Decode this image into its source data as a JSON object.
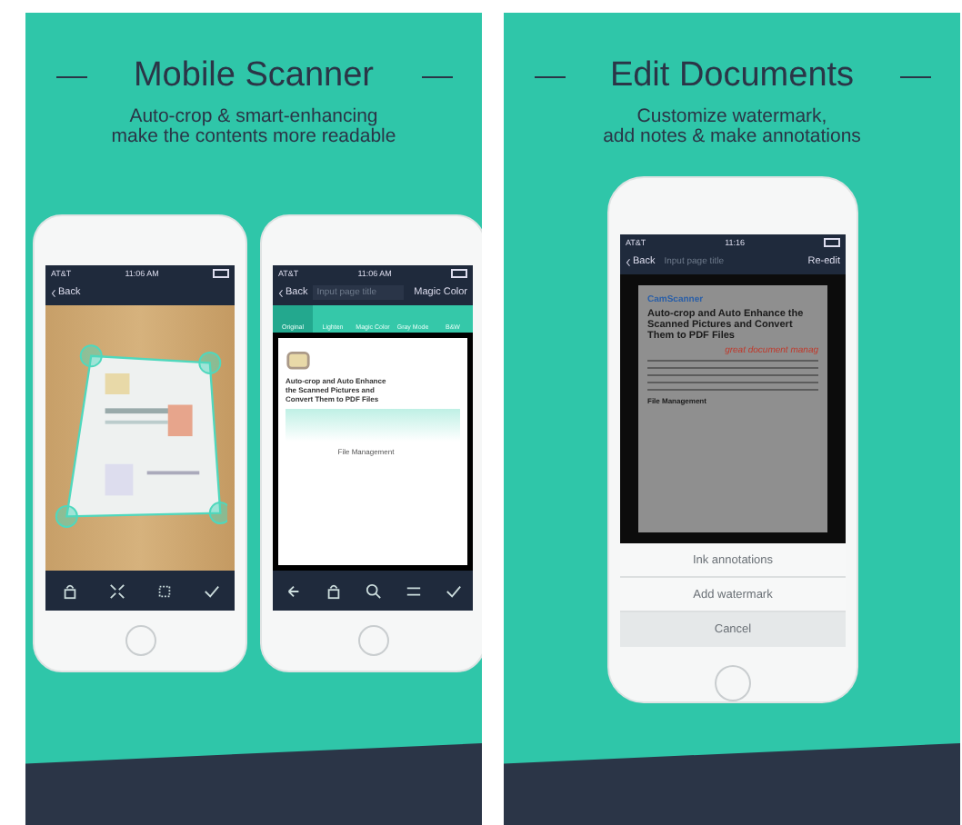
{
  "panels": [
    {
      "title": "Mobile Scanner",
      "subtitle": [
        "Auto-crop & smart-enhancing",
        "make the contents more readable"
      ],
      "phones": [
        {
          "kind": "crop",
          "carrier": "AT&T",
          "time": "11:06 AM",
          "back": "Back"
        },
        {
          "kind": "filter",
          "carrier": "AT&T",
          "time": "11:06 AM",
          "back": "Back",
          "placeholder": "Input page title",
          "action": "Magic Color",
          "filters": [
            {
              "label": "Original",
              "selected": true
            },
            {
              "label": "Lighten",
              "selected": false
            },
            {
              "label": "Magic Color",
              "selected": false
            },
            {
              "label": "Gray Mode",
              "selected": false
            },
            {
              "label": "B&W",
              "selected": false
            }
          ],
          "doc_heading": "Auto-crop and Auto Enhance the Scanned Pictures and Convert Them to PDF Files",
          "doc_section": "File Management"
        }
      ]
    },
    {
      "title": "Edit Documents",
      "subtitle": [
        "Customize watermark,",
        "add notes & make annotations"
      ],
      "phones": [
        {
          "kind": "edit",
          "carrier": "AT&T",
          "time": "11:16",
          "back": "Back",
          "placeholder": "Input page title",
          "action": "Re-edit",
          "doc_brand": "CamScanner",
          "doc_heading": "Auto-crop and Auto Enhance the Scanned Pictures and Convert Them to PDF Files",
          "doc_note": "great document manag",
          "doc_section": "File Management",
          "options": [
            "Ink annotations",
            "Add watermark"
          ],
          "cancel": "Cancel"
        }
      ]
    }
  ]
}
